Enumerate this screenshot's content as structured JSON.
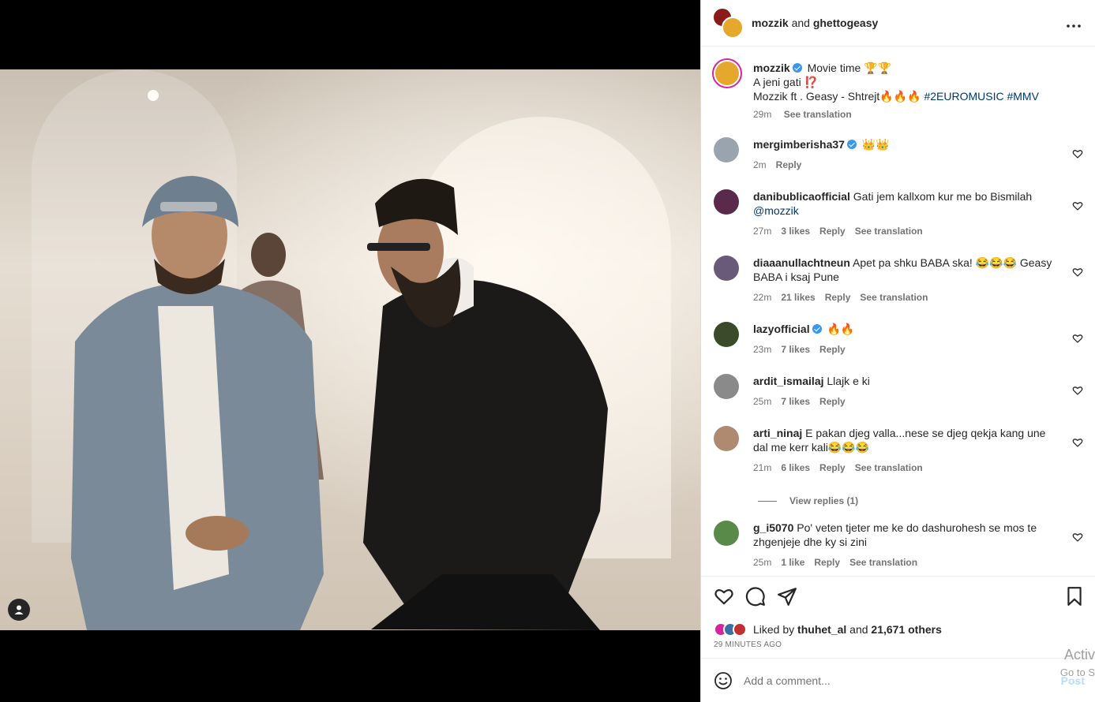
{
  "header": {
    "user1": "mozzik",
    "and": "and",
    "user2": "ghettogeasy"
  },
  "caption": {
    "username": "mozzik",
    "line1": "Movie time 🏆🏆",
    "line2": "A jeni gati ⁉️",
    "line3": "Mozzik ft . Geasy - Shtrejt🔥🔥🔥 ",
    "hashtags": "#2EUROMUSIC #MMV",
    "time": "29m",
    "see_translation": "See translation"
  },
  "comments": [
    {
      "username": "mergimberisha37",
      "verified": true,
      "text": "👑👑",
      "time": "2m",
      "likes": "",
      "reply": "Reply",
      "translate": ""
    },
    {
      "username": "danibublicaofficial",
      "verified": false,
      "text": "Gati jem kallxom kur me bo Bismilah",
      "mention": "@mozzik",
      "time": "27m",
      "likes": "3 likes",
      "reply": "Reply",
      "translate": "See translation"
    },
    {
      "username": "diaaanullachtneun",
      "verified": false,
      "text": "Apet pa shku BABA ska! 😂😂😂 Geasy BABA i ksaj Pune",
      "time": "22m",
      "likes": "21 likes",
      "reply": "Reply",
      "translate": "See translation"
    },
    {
      "username": "lazyofficial",
      "verified": true,
      "text": "🔥🔥",
      "time": "23m",
      "likes": "7 likes",
      "reply": "Reply",
      "translate": ""
    },
    {
      "username": "ardit_ismailaj",
      "verified": false,
      "text": "Llajk e ki",
      "time": "25m",
      "likes": "7 likes",
      "reply": "Reply",
      "translate": ""
    },
    {
      "username": "arti_ninaj",
      "verified": false,
      "text": "E pakan djeg valla...nese se djeg qekja kang une dal me kerr kali😂😂😂",
      "time": "21m",
      "likes": "6 likes",
      "reply": "Reply",
      "translate": "See translation"
    },
    {
      "username": "g_i5070",
      "verified": false,
      "text": "Po' veten tjeter me ke do dashurohesh se mos te zhgenjeje dhe ky si zini",
      "time": "25m",
      "likes": "1 like",
      "reply": "Reply",
      "translate": "See translation"
    }
  ],
  "view_replies": "View replies (1)",
  "likes": {
    "prefix": "Liked by",
    "user": "thuhet_al",
    "suffix": "and",
    "others": "21,671 others"
  },
  "time_ago": "29 MINUTES AGO",
  "add_comment": {
    "placeholder": "Add a comment...",
    "post": "Post"
  },
  "watermark": {
    "line1": "Activ",
    "line2": "Go to S"
  },
  "icons": [
    "more-icon",
    "verified-icon",
    "heart-icon",
    "comment-icon",
    "share-icon",
    "bookmark-icon",
    "emoji-icon",
    "user-tag-icon"
  ]
}
